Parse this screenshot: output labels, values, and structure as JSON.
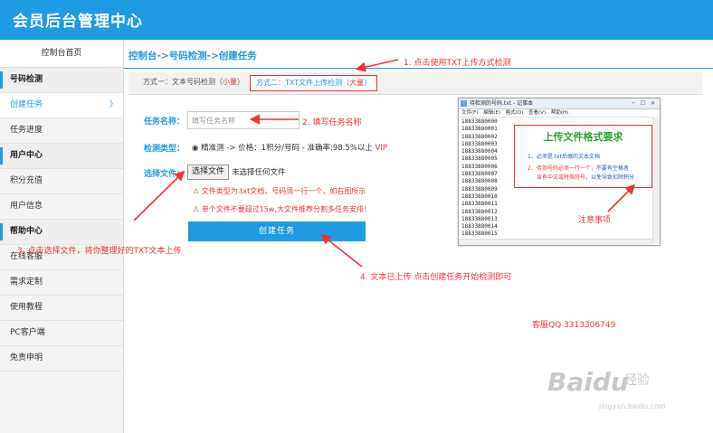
{
  "header": {
    "title": "会员后台管理中心"
  },
  "sidebar": {
    "top": "控制台首页",
    "items": [
      {
        "label": "号码检测",
        "kind": "sec"
      },
      {
        "label": "创建任务",
        "kind": "active",
        "chev": "〉"
      },
      {
        "label": "任务进度",
        "kind": ""
      },
      {
        "label": "用户中心",
        "kind": "sec"
      },
      {
        "label": "积分充值",
        "kind": ""
      },
      {
        "label": "用户信息",
        "kind": ""
      },
      {
        "label": "帮助中心",
        "kind": "sec"
      },
      {
        "label": "在线客服",
        "kind": ""
      },
      {
        "label": "需求定制",
        "kind": ""
      },
      {
        "label": "使用教程",
        "kind": ""
      },
      {
        "label": "PC客户端",
        "kind": ""
      },
      {
        "label": "免责申明",
        "kind": ""
      }
    ]
  },
  "breadcrumb": "控制台->号码检测->创建任务",
  "tabs": {
    "tab1": "方式一：文本号码检测（",
    "tab1_red": "小量",
    "tab1_end": "）",
    "tab2": "方式二：TXT文件上传检测（",
    "tab2_red": "大量",
    "tab2_end": "）"
  },
  "form": {
    "name_label": "任务名称：",
    "name_placeholder": "填写任务名称",
    "type_label": "检测类型：",
    "type_text": "◉ 精准测 -> 价格：1积分/号码 - 准确率:98.5%以上 ",
    "type_vip": "VIP",
    "file_label": "选择文件：",
    "file_button": "选择文件",
    "file_status": "未选择任何文件",
    "warn1": "⚠ 文件类型为.txt文档，号码须一行一个，如右图所示",
    "warn2": "⚠ 单个文件不要超过15w,大文件推荐分割多任务安排！",
    "create_button": "创建任务"
  },
  "annotations": {
    "a1": "1. 点击使用TXT上传方式检测",
    "a2": "2. 填写任务名称",
    "a3": "3. 点击选择文件，将你整理好的TXT文本上传",
    "a4": "4. 文本已上传 点击创建任务开始检测即可",
    "notice": "注意事项",
    "service": "客服QQ 3313306749"
  },
  "notepad": {
    "title": "待检测的号码.txt - 记事本",
    "controls": "─ ☐ ✕",
    "menu": "文件(F) 编辑(E) 格式(O) 查看(V) 帮助(H)",
    "lines": [
      "18833880000",
      "18833880001",
      "18833880002",
      "18833880003",
      "18833880004",
      "18833880005",
      "18833880006",
      "18833880007",
      "18833880008",
      "18833880009",
      "18833880010",
      "18833880011",
      "18833880012",
      "18833880013",
      "18833880014",
      "18833880015",
      "18833880016"
    ]
  },
  "format_box": {
    "title": "上传文件格式要求",
    "l1": "1、必须是.txt后缀的文本文档",
    "l2a": "2、待测号码必须一行一个，",
    "l2b": "不要有空格者",
    "l3a": "含有中文或特殊符号",
    "l3b": "，以免导致扣除积分"
  },
  "watermark": {
    "brand": "Bai",
    "brand2": "du",
    "jy": "经验",
    "url": "jingyan.baidu.com"
  },
  "colors": {
    "primary": "#1e9be3",
    "annotation": "#e33333"
  }
}
